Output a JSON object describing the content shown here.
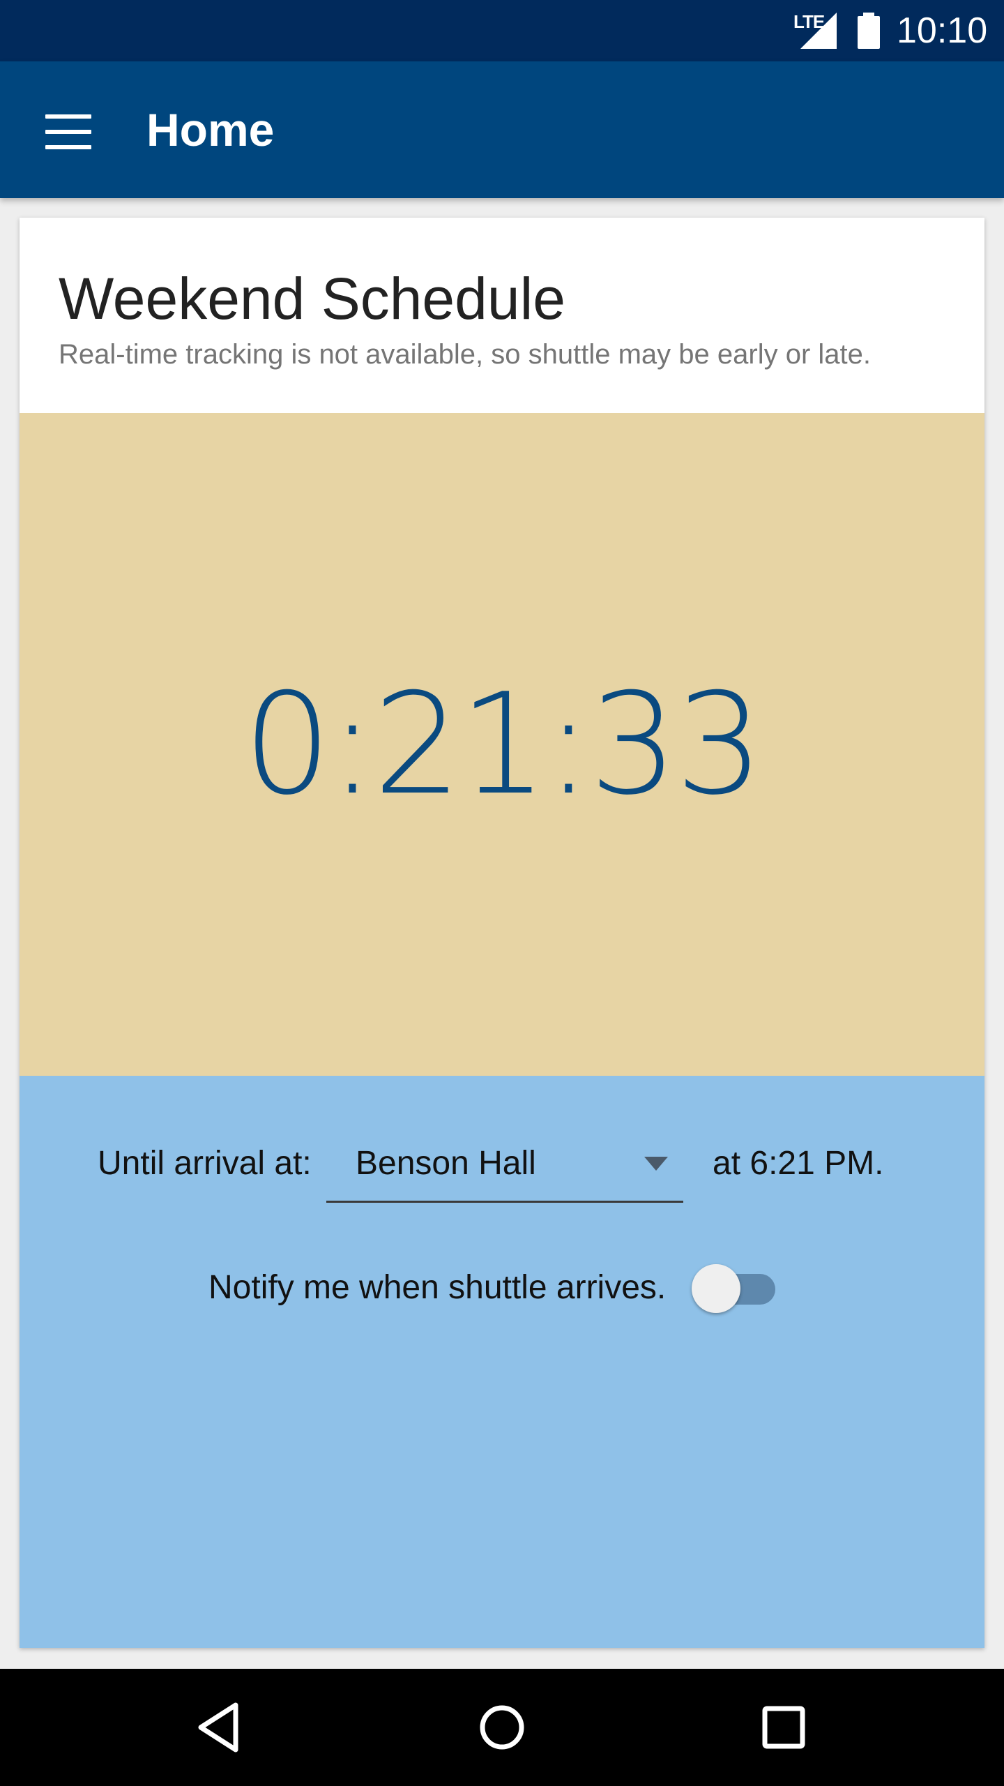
{
  "status_bar": {
    "network_label": "LTE",
    "time": "10:10",
    "icons": [
      "lte-signal-icon",
      "battery-icon"
    ]
  },
  "app_bar": {
    "title": "Home",
    "menu_icon": "hamburger-menu-icon"
  },
  "card": {
    "title": "Weekend Schedule",
    "subtitle": "Real-time tracking is not available, so shuttle may be early or late.",
    "countdown": "0:21:33",
    "until_label": "Until arrival at:",
    "stop_select": {
      "selected": "Benson Hall",
      "icon": "dropdown-arrow-icon"
    },
    "arrival_time": "at 6:21 PM.",
    "notify_label": "Notify me when shuttle arrives.",
    "notify_toggle_on": false
  },
  "colors": {
    "status_bar": "#012a5c",
    "app_bar": "#00467e",
    "timer_panel": "#e7d4a4",
    "info_panel": "#8fc1e8",
    "countdown_text": "#0a4a80"
  },
  "nav_bar": {
    "icons": [
      "back-icon",
      "home-icon",
      "recents-icon"
    ]
  }
}
